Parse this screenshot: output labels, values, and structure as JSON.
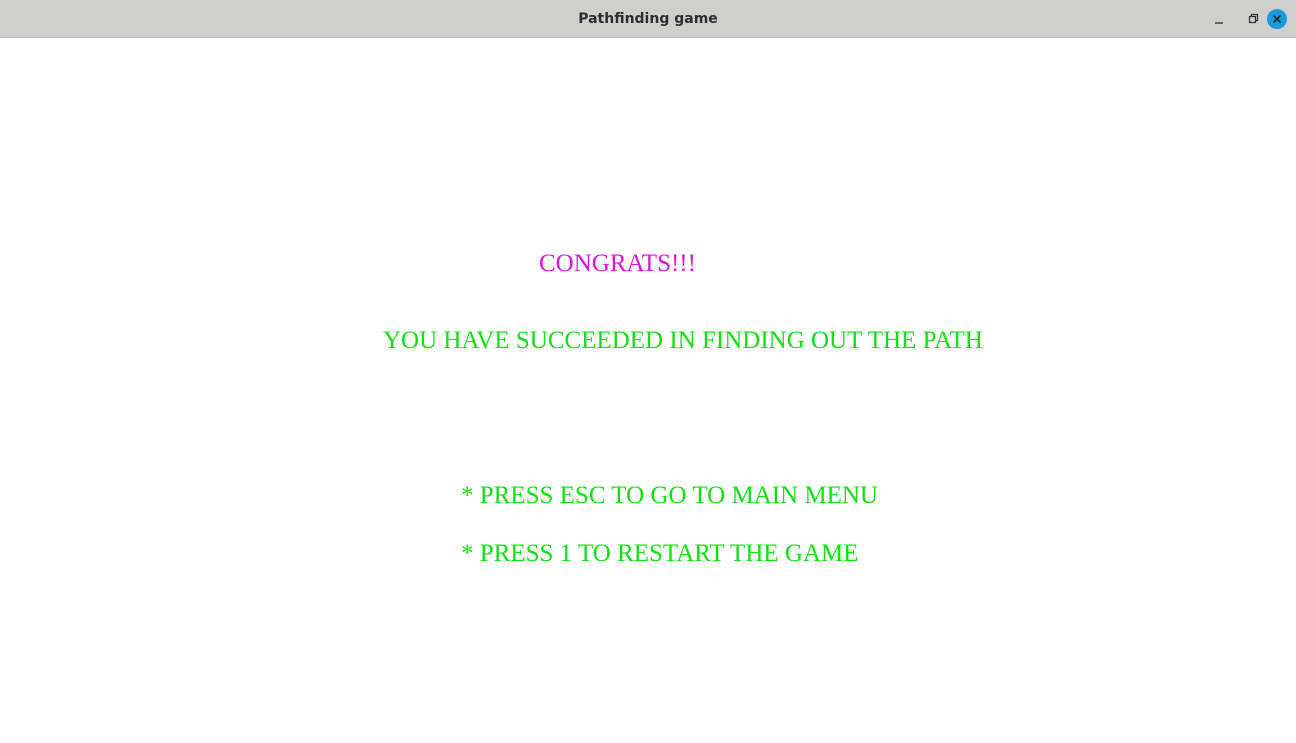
{
  "window": {
    "title": "Pathfinding game",
    "controls": {
      "minimize_icon": "minimize-icon",
      "maximize_icon": "maximize-icon",
      "close_icon": "close-icon",
      "close_color": "#1a9ad8"
    }
  },
  "game": {
    "congrats_text": "CONGRATS!!!",
    "success_text": "YOU HAVE SUCCEEDED IN FINDING OUT THE PATH",
    "options": [
      "* PRESS ESC TO GO TO MAIN MENU",
      "* PRESS 1 TO RESTART THE GAME"
    ],
    "colors": {
      "congrats": "#e010e0",
      "text": "#11e011",
      "background": "#ffffff"
    }
  }
}
